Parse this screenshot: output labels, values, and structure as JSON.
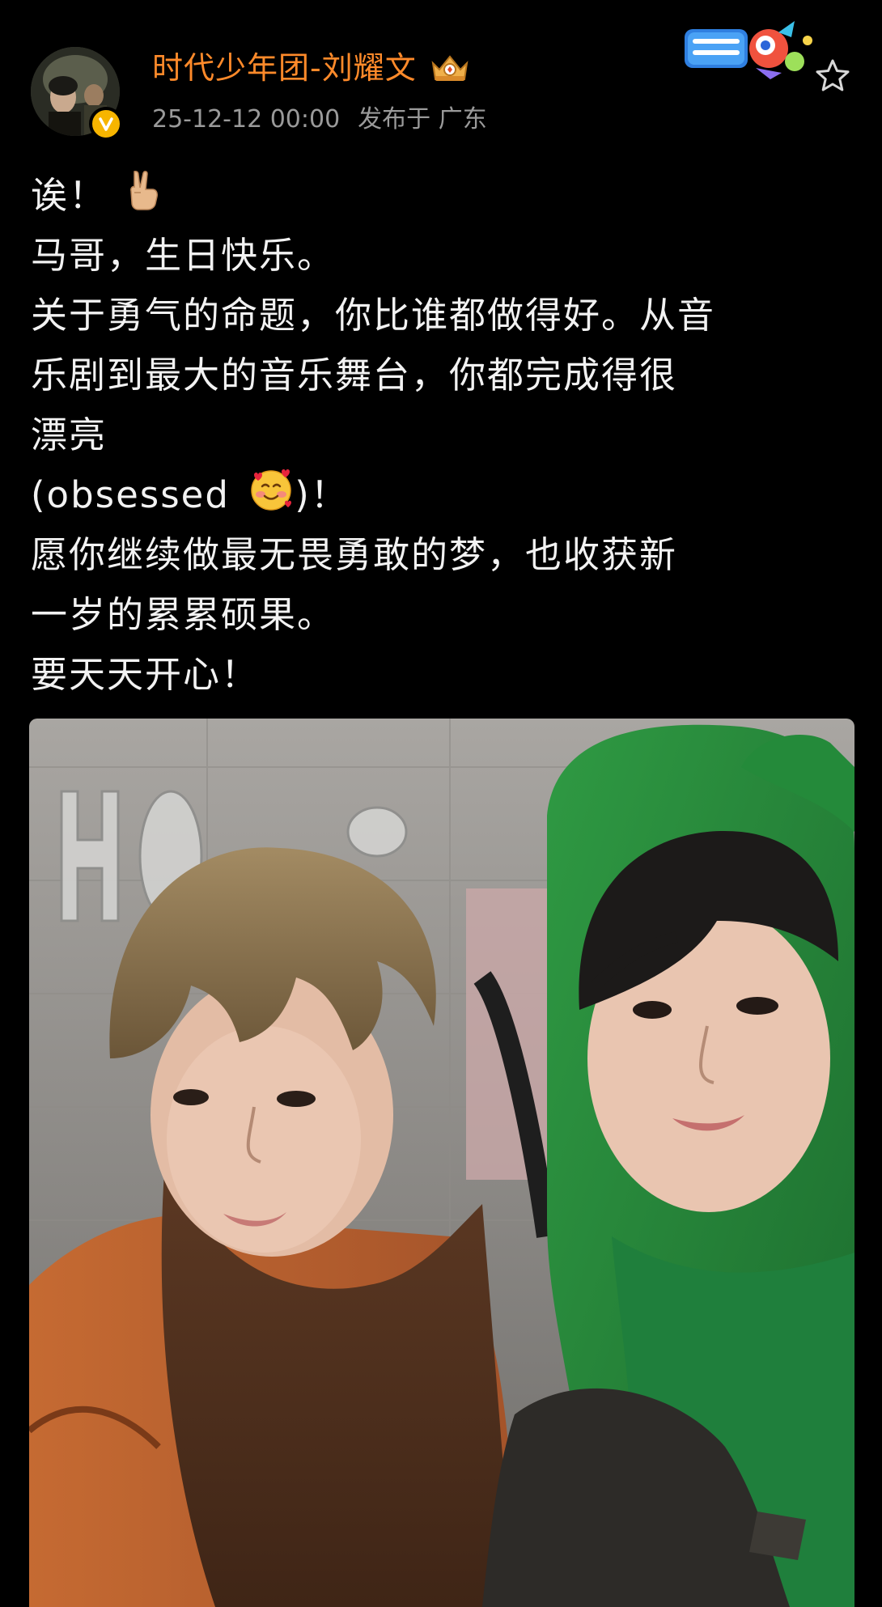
{
  "post": {
    "author": {
      "name": "时代少年团-刘耀文",
      "avatar_icon": "user-avatar",
      "verified_icon": "verified-v-icon",
      "crown_icon": "member-crown-icon"
    },
    "meta": {
      "timestamp": "25-12-12 00:00",
      "location": "发布于 广东"
    },
    "event_badge_icon": "national-day-badge-icon",
    "favorite_icon": "star-outline-icon",
    "text_lines": [
      "诶！",
      "马哥，生日快乐。",
      "关于勇气的命题，你比谁都做得好。从音",
      "乐剧到最大的音乐舞台，你都完成得很",
      "漂亮",
      "(obsessed ",
      ")！",
      "愿你继续做最无畏勇敢的梦，也收获新",
      "一岁的累累硕果。",
      "要天天开心！"
    ],
    "emojis": {
      "line1": "victory-hand-emoji",
      "line6": "smiling-face-with-hearts-emoji"
    },
    "photo": {
      "description_icon": "selfie-photo"
    }
  },
  "colors": {
    "background": "#000000",
    "username": "#ff8a2a",
    "meta_text": "#9a9a9a",
    "body_text": "#f2f2f2",
    "verified_badge": "#f7b500"
  }
}
